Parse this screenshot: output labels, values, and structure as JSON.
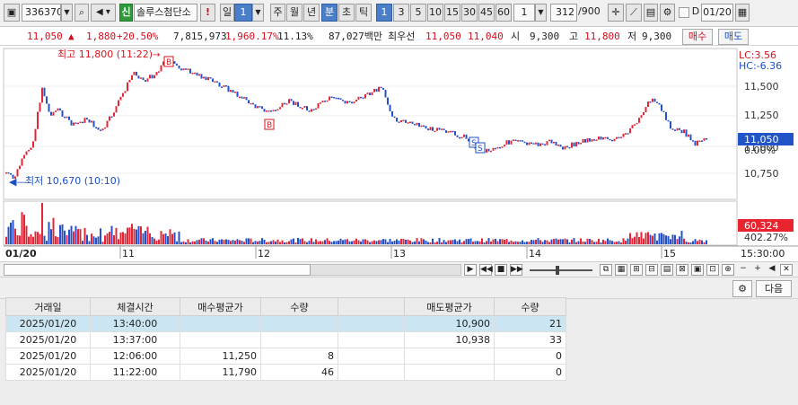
{
  "toolbar": {
    "code": "336370",
    "credit_tag": "신",
    "name": "솔루스첨단소",
    "warn": "!",
    "period_day": "일",
    "period_day_n": "1",
    "period_week": "주",
    "period_month": "월",
    "period_year": "년",
    "period_min": "분",
    "period_sec": "초",
    "period_tick": "틱",
    "minutes": [
      "1",
      "3",
      "5",
      "10",
      "15",
      "30",
      "45",
      "60"
    ],
    "interval_value": "1",
    "count": "312",
    "count_total": "/900",
    "d_label": "D",
    "date": "01/20"
  },
  "quote": {
    "price": "11,050",
    "change": "1,880",
    "rate": "+20.50%",
    "volume": "7,815,973",
    "volume_rate": "1,960.17%",
    "turnover_rate": "11.13%",
    "amount": "87,027백만",
    "priority_label": "최우선",
    "ask": "11,050",
    "bid": "11,040",
    "open_label": "시",
    "open": "9,300",
    "high_label": "고",
    "high": "11,800",
    "low_label": "저",
    "low": "9,300",
    "buy_btn": "매수",
    "sell_btn": "매도"
  },
  "chart": {
    "lc": "LC:3.56",
    "hc": "HC:-6.36",
    "price_ticks": [
      "11,500",
      "11,250",
      "11,000",
      "10,750"
    ],
    "current_price": "11,050",
    "current_rate": "0.00%",
    "high_marker": "최고 11,800 (11:22)",
    "low_marker": "최저 10,670 (10:10)",
    "buy_mark": "B",
    "sell_mark": "S",
    "volume_value": "60,324",
    "volume_rate": "402.27%",
    "time_labels": [
      "01/20",
      "11",
      "12",
      "13",
      "14",
      "15"
    ],
    "end_time": "15:30:00",
    "colors": {
      "up": "#e32636",
      "down": "#2450c8",
      "volume_highlight": "#e8252f"
    }
  },
  "order": {
    "next_btn": "다음",
    "headers": [
      "거래일",
      "체결시간",
      "매수평균가",
      "수량",
      "",
      "매도평균가",
      "수량"
    ],
    "rows": [
      [
        "2025/01/20",
        "13:40:00",
        "",
        "",
        "",
        "10,900",
        "21"
      ],
      [
        "2025/01/20",
        "13:37:00",
        "",
        "",
        "",
        "10,938",
        "33"
      ],
      [
        "2025/01/20",
        "12:06:00",
        "11,250",
        "8",
        "",
        "",
        "0"
      ],
      [
        "2025/01/20",
        "11:22:00",
        "11,790",
        "46",
        "",
        "",
        "0"
      ]
    ]
  }
}
